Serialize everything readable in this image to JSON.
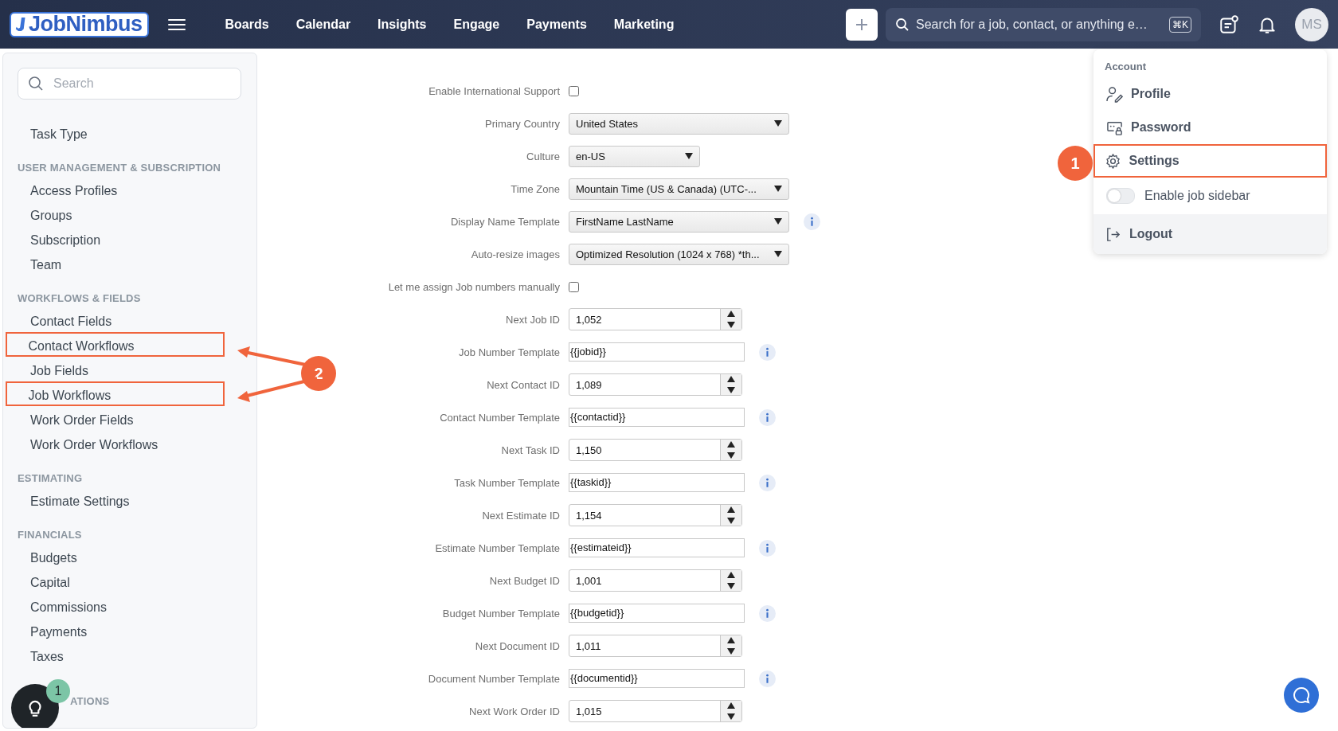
{
  "topbar": {
    "logo": "JobNimbus",
    "nav": [
      "Boards",
      "Calendar",
      "Insights",
      "Engage",
      "Payments",
      "Marketing"
    ],
    "search": {
      "placeholder": "Search for a job, contact, or anything e…",
      "shortcut": "⌘K"
    },
    "avatar": "MS"
  },
  "sidebar": {
    "search": {
      "placeholder": "Search"
    },
    "sections": [
      {
        "items": [
          {
            "label": "Task Type",
            "highlighted": false
          }
        ]
      },
      {
        "title": "USER MANAGEMENT & SUBSCRIPTION",
        "items": [
          {
            "label": "Access Profiles",
            "highlighted": false
          },
          {
            "label": "Groups",
            "highlighted": false
          },
          {
            "label": "Subscription",
            "highlighted": false
          },
          {
            "label": "Team",
            "highlighted": false
          }
        ]
      },
      {
        "title": "WORKFLOWS & FIELDS",
        "items": [
          {
            "label": "Contact Fields",
            "highlighted": false
          },
          {
            "label": "Contact Workflows",
            "highlighted": true
          },
          {
            "label": "Job Fields",
            "highlighted": false
          },
          {
            "label": "Job Workflows",
            "highlighted": true
          },
          {
            "label": "Work Order Fields",
            "highlighted": false
          },
          {
            "label": "Work Order Workflows",
            "highlighted": false
          }
        ]
      },
      {
        "title": "ESTIMATING",
        "items": [
          {
            "label": "Estimate Settings",
            "highlighted": false
          }
        ]
      },
      {
        "title": "FINANCIALS",
        "items": [
          {
            "label": "Budgets",
            "highlighted": false
          },
          {
            "label": "Capital",
            "highlighted": false
          },
          {
            "label": "Commissions",
            "highlighted": false
          },
          {
            "label": "Payments",
            "highlighted": false
          },
          {
            "label": "Taxes",
            "highlighted": false
          }
        ]
      },
      {
        "title": "ATIONS"
      }
    ],
    "tips_badge": "1"
  },
  "form": [
    {
      "kind": "checkbox",
      "label": "Enable International Support",
      "checked": false
    },
    {
      "kind": "select",
      "label": "Primary Country",
      "value": "United States"
    },
    {
      "kind": "minselect",
      "label": "Culture",
      "value": "en-US"
    },
    {
      "kind": "select",
      "label": "Time Zone",
      "value": "Mountain Time (US & Canada) (UTC-..."
    },
    {
      "kind": "select",
      "label": "Display Name Template",
      "value": "FirstName LastName",
      "info": true
    },
    {
      "kind": "select",
      "label": "Auto-resize images",
      "value": "Optimized Resolution (1024 x 768) *th..."
    },
    {
      "kind": "checkbox",
      "label": "Let me assign Job numbers manually",
      "checked": false
    },
    {
      "kind": "number",
      "label": "Next Job ID",
      "value": "1,052"
    },
    {
      "kind": "text",
      "label": "Job Number Template",
      "value": "{{jobid}}",
      "info": true
    },
    {
      "kind": "number",
      "label": "Next Contact ID",
      "value": "1,089"
    },
    {
      "kind": "text",
      "label": "Contact Number Template",
      "value": "{{contactid}}",
      "info": true
    },
    {
      "kind": "number",
      "label": "Next Task ID",
      "value": "1,150"
    },
    {
      "kind": "text",
      "label": "Task Number Template",
      "value": "{{taskid}}",
      "info": true
    },
    {
      "kind": "number",
      "label": "Next Estimate ID",
      "value": "1,154"
    },
    {
      "kind": "text",
      "label": "Estimate Number Template",
      "value": "{{estimateid}}",
      "info": true
    },
    {
      "kind": "number",
      "label": "Next Budget ID",
      "value": "1,001"
    },
    {
      "kind": "text",
      "label": "Budget Number Template",
      "value": "{{budgetid}}",
      "info": true
    },
    {
      "kind": "number",
      "label": "Next Document ID",
      "value": "1,011"
    },
    {
      "kind": "text",
      "label": "Document Number Template",
      "value": "{{documentid}}",
      "info": true
    },
    {
      "kind": "number",
      "label": "Next Work Order ID",
      "value": "1,015"
    }
  ],
  "account_menu": {
    "title": "Account",
    "items": [
      {
        "kind": "profile",
        "label": "Profile",
        "highlighted": false
      },
      {
        "kind": "password",
        "label": "Password",
        "highlighted": false
      },
      {
        "kind": "settings",
        "label": "Settings",
        "highlighted": true
      },
      {
        "kind": "toggle",
        "label": "Enable job sidebar",
        "on": false
      }
    ],
    "logout": "Logout"
  },
  "callouts": [
    {
      "label": "1"
    },
    {
      "label": "2"
    }
  ]
}
